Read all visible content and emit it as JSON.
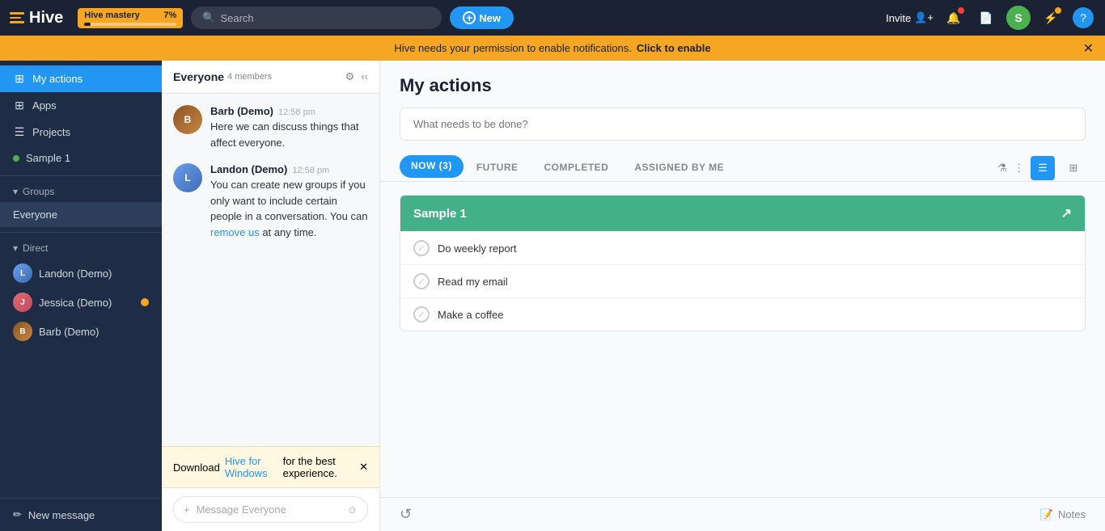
{
  "topbar": {
    "logo_text": "Hive",
    "mastery_label": "Hive mastery",
    "mastery_percent": "7%",
    "search_placeholder": "Search",
    "new_button_label": "New",
    "invite_label": "Invite"
  },
  "notification_banner": {
    "text": "Hive needs your permission to enable notifications.",
    "link_text": "Click to enable"
  },
  "sidebar": {
    "my_actions_label": "My actions",
    "apps_label": "Apps",
    "projects_label": "Projects",
    "sample1_label": "Sample 1",
    "groups_label": "Groups",
    "everyone_label": "Everyone",
    "direct_label": "Direct",
    "users": [
      {
        "name": "Landon (Demo)",
        "initials": "L"
      },
      {
        "name": "Jessica (Demo)",
        "initials": "J",
        "unread": true
      },
      {
        "name": "Barb (Demo)",
        "initials": "B"
      }
    ],
    "new_message_label": "New message"
  },
  "middle_panel": {
    "channel_name": "Everyone",
    "member_count": "4 members",
    "messages": [
      {
        "author": "Barb (Demo)",
        "time": "12:58 pm",
        "text": "Here we can discuss things that affect everyone.",
        "initials": "B"
      },
      {
        "author": "Landon (Demo)",
        "time": "12:58 pm",
        "text": "You can create new groups if you only want to include certain people in a conversation. You can",
        "link": "remove us",
        "text_after": " at any time.",
        "initials": "L"
      }
    ],
    "message_placeholder": "Message Everyone",
    "download_text": "Download",
    "download_link": "Hive for Windows",
    "download_text2": "for the best experience."
  },
  "right_panel": {
    "title": "My actions",
    "task_placeholder": "What needs to be done?",
    "tabs": [
      {
        "label": "NOW (3)",
        "active": true
      },
      {
        "label": "FUTURE",
        "active": false
      },
      {
        "label": "COMPLETED",
        "active": false
      },
      {
        "label": "ASSIGNED BY ME",
        "active": false
      }
    ],
    "project_group": {
      "name": "Sample 1",
      "tasks": [
        {
          "label": "Do weekly report"
        },
        {
          "label": "Read my email"
        },
        {
          "label": "Make a coffee"
        }
      ]
    },
    "notes_label": "Notes"
  }
}
